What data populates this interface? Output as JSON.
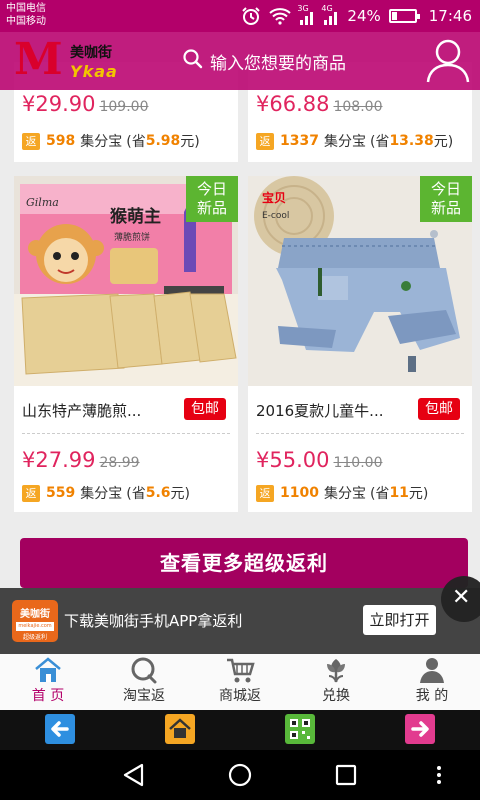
{
  "status": {
    "carrier1": "中国电信",
    "carrier2": "中国移动",
    "network1": "3G",
    "network2": "4G",
    "battery_percent": "24%",
    "battery_level": 0.24,
    "time": "17:46"
  },
  "header": {
    "logo_letter": "M",
    "logo_cn": "美咖街",
    "logo_en": "Ykaa",
    "search_placeholder": "输入您想要的商品"
  },
  "top_products": [
    {
      "price": "¥29.90",
      "original": "109.00",
      "rebate_badge": "返",
      "points": "598",
      "unit": "集分宝",
      "save_prefix": "(省",
      "save": "5.98",
      "save_suffix": "元)"
    },
    {
      "price": "¥66.88",
      "original": "108.00",
      "rebate_badge": "返",
      "points": "1337",
      "unit": "集分宝",
      "save_prefix": "(省",
      "save": "13.38",
      "save_suffix": "元)"
    }
  ],
  "products": [
    {
      "name": "山东特产薄脆煎...",
      "free_shipping": "包邮",
      "new_badge_line1": "今日",
      "new_badge_line2": "新品",
      "price": "¥27.99",
      "original": "28.99",
      "rebate_badge": "返",
      "points": "559",
      "unit": "集分宝",
      "save_prefix": "(省",
      "save": "5.6",
      "save_suffix": "元)",
      "img_brand": "Gilma",
      "img_title": "猴萌主",
      "img_sub": "薄脆煎饼"
    },
    {
      "name": "2016夏款儿童牛...",
      "free_shipping": "包邮",
      "new_badge_line1": "今日",
      "new_badge_line2": "新品",
      "price": "¥55.00",
      "original": "110.00",
      "rebate_badge": "返",
      "points": "1100",
      "unit": "集分宝",
      "save_prefix": "(省",
      "save": "11",
      "save_suffix": "元)",
      "img_brand": "宝贝",
      "img_sub": "E-cool"
    }
  ],
  "more_button": "查看更多超级返利",
  "download_banner": {
    "app_name": "美咖街",
    "app_url": "meikajie.com",
    "app_tag": "超级返利",
    "text": "下载美咖街手机APP拿返利",
    "open_button": "立即打开",
    "close_symbol": "✕"
  },
  "tabs": [
    {
      "label": "首 页",
      "icon": "home-icon",
      "active": true
    },
    {
      "label": "淘宝返",
      "icon": "taobao-icon",
      "active": false
    },
    {
      "label": "商城返",
      "icon": "cart-icon",
      "active": false
    },
    {
      "label": "兑换",
      "icon": "flower-icon",
      "active": false
    },
    {
      "label": "我 的",
      "icon": "person-icon",
      "active": false
    }
  ],
  "colors": {
    "brand": "#b3006a",
    "price": "#e0245e",
    "rebate": "#f08200",
    "new_badge": "#5cb531",
    "free_ship": "#e60012"
  }
}
